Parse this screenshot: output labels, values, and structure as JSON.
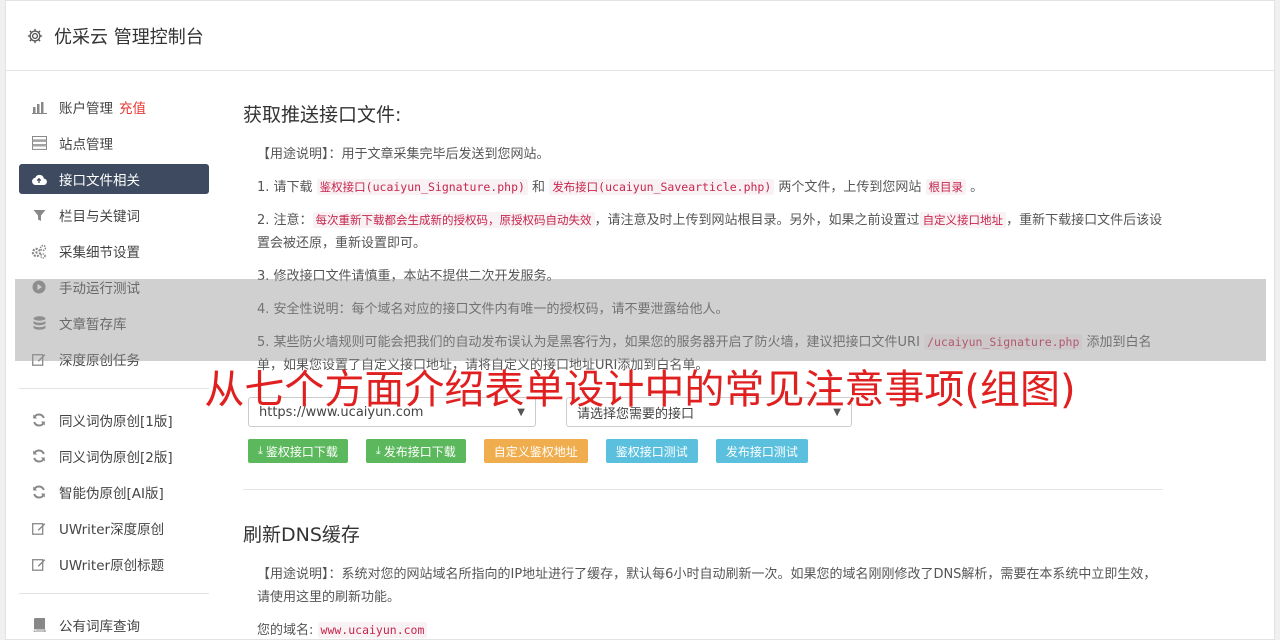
{
  "header": {
    "title": "优采云 管理控制台"
  },
  "sidebar": {
    "items": [
      {
        "label": "账户管理",
        "icon": "bar-chart-icon",
        "extra": "充值"
      },
      {
        "label": "站点管理",
        "icon": "server-icon"
      },
      {
        "label": "接口文件相关",
        "icon": "cloud-upload-icon",
        "active": true
      },
      {
        "label": "栏目与关键词",
        "icon": "filter-icon"
      },
      {
        "label": "采集细节设置",
        "icon": "gears-icon"
      },
      {
        "label": "手动运行测试",
        "icon": "play-circle-icon"
      },
      {
        "label": "文章暂存库",
        "icon": "database-icon"
      },
      {
        "label": "深度原创任务",
        "icon": "edit-icon"
      }
    ],
    "items2": [
      {
        "label": "同义词伪原创[1版]",
        "icon": "refresh-icon"
      },
      {
        "label": "同义词伪原创[2版]",
        "icon": "refresh-icon"
      },
      {
        "label": "智能伪原创[AI版]",
        "icon": "refresh-icon"
      },
      {
        "label": "UWriter深度原创",
        "icon": "edit-icon"
      },
      {
        "label": "UWriter原创标题",
        "icon": "edit-icon"
      }
    ],
    "items3": [
      {
        "label": "公有词库查询",
        "icon": "book-icon"
      }
    ]
  },
  "section1": {
    "title": "获取推送接口文件:",
    "usage": "【用途说明】：用于文章采集完毕后发送到您网站。",
    "p1": {
      "a": "1. 请下载 ",
      "c1": "鉴权接口(ucaiyun_Signature.php)",
      "b": " 和 ",
      "c2": "发布接口(ucaiyun_Savearticle.php)",
      "d": " 两个文件，上传到您网站 ",
      "c3": "根目录",
      "e": " 。"
    },
    "p2": {
      "a": "2. 注意：",
      "c1": "每次重新下载都会生成新的授权码，原授权码自动失效",
      "b": "，请注意及时上传到网站根目录。另外，如果之前设置过",
      "c2": "自定义接口地址",
      "d": "，重新下载接口文件后该设置会被还原，重新设置即可。"
    },
    "p3": "3. 修改接口文件请慎重，本站不提供二次开发服务。",
    "p4": "4. 安全性说明：每个域名对应的接口文件内有唯一的授权码，请不要泄露给他人。",
    "p5": {
      "a": "5. 某些防火墙规则可能会把我们的自动发布误认为是黑客行为，如果您的服务器开启了防火墙，建议把接口文件URI ",
      "c1": "/ucaiyun_Signature.php",
      "b": " 添加到白名单，如果您设置了自定义接口地址，请将自定义的接口地址URI添加到白名单。"
    },
    "select_site": "https://www.ucaiyun.com",
    "select_api": "请选择您需要的接口",
    "buttons": {
      "b1": "鉴权接口下载",
      "b2": "发布接口下载",
      "b3": "自定义鉴权地址",
      "b4": "鉴权接口测试",
      "b5": "发布接口测试"
    }
  },
  "section2": {
    "title": "刷新DNS缓存",
    "usage": "【用途说明】：系统对您的网站域名所指向的IP地址进行了缓存，默认每6小时自动刷新一次。如果您的域名刚刚修改了DNS解析，需要在本系统中立即生效，请使用这里的刷新功能。",
    "domain_label": "您的域名:",
    "domain_value": "www.ucaiyun.com"
  },
  "overlay": {
    "title": "从七个方面介绍表单设计中的常见注意事项(组图)"
  },
  "colors": {
    "active_nav": "#3d4a5f",
    "green": "#5cb85c",
    "orange": "#f0ad4e",
    "blue": "#5bc0de",
    "overlay_text": "#e02020"
  }
}
